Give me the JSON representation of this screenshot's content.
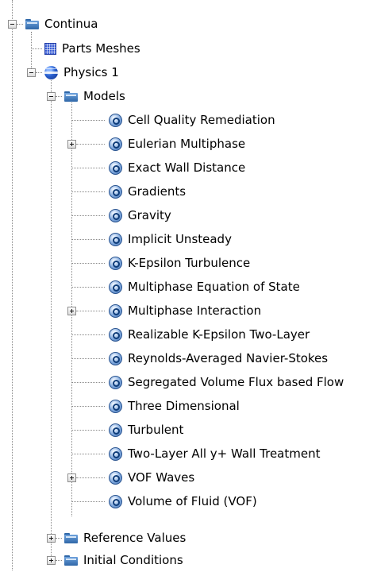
{
  "tree": {
    "continua": {
      "label": "Continua",
      "icon": "folder-icon",
      "expanded": true
    },
    "parts_meshes": {
      "label": "Parts Meshes",
      "icon": "mesh-icon"
    },
    "physics": {
      "label": "Physics 1",
      "icon": "physics-icon",
      "expanded": true
    },
    "models": {
      "label": "Models",
      "icon": "folder-icon",
      "expanded": true,
      "items": [
        {
          "label": "Cell Quality Remediation",
          "expandable": false
        },
        {
          "label": "Eulerian Multiphase",
          "expandable": true
        },
        {
          "label": "Exact Wall Distance",
          "expandable": false
        },
        {
          "label": "Gradients",
          "expandable": false
        },
        {
          "label": "Gravity",
          "expandable": false
        },
        {
          "label": "Implicit Unsteady",
          "expandable": false
        },
        {
          "label": "K-Epsilon Turbulence",
          "expandable": false
        },
        {
          "label": "Multiphase Equation of State",
          "expandable": false
        },
        {
          "label": "Multiphase Interaction",
          "expandable": true
        },
        {
          "label": "Realizable K-Epsilon Two-Layer",
          "expandable": false
        },
        {
          "label": "Reynolds-Averaged Navier-Stokes",
          "expandable": false
        },
        {
          "label": "Segregated Volume Flux based Flow",
          "expandable": false
        },
        {
          "label": "Three Dimensional",
          "expandable": false
        },
        {
          "label": "Turbulent",
          "expandable": false
        },
        {
          "label": "Two-Layer All y+ Wall Treatment",
          "expandable": false
        },
        {
          "label": "VOF Waves",
          "expandable": true
        },
        {
          "label": "Volume of Fluid (VOF)",
          "expandable": false
        }
      ]
    },
    "reference_values": {
      "label": "Reference Values",
      "icon": "folder-icon",
      "expanded": false
    },
    "initial_conditions": {
      "label": "Initial Conditions",
      "icon": "folder-icon",
      "expanded": false
    }
  },
  "colors": {
    "folder": "#2f67a8",
    "connector": "#8a8a8a",
    "model_icon": "#3f6fb0",
    "mesh": "#3b5fd6"
  }
}
